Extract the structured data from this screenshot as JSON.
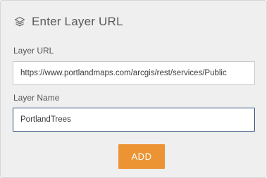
{
  "header": {
    "title": "Enter Layer URL",
    "icon": "layers-icon"
  },
  "form": {
    "layer_url": {
      "label": "Layer URL",
      "value": "https://www.portlandmaps.com/arcgis/rest/services/Public"
    },
    "layer_name": {
      "label": "Layer Name",
      "value": "PortlandTrees"
    },
    "add_label": "ADD"
  },
  "colors": {
    "panel_background": "#efefef",
    "button_accent": "#ec9434",
    "focused_input_border": "#2f4f7a"
  }
}
